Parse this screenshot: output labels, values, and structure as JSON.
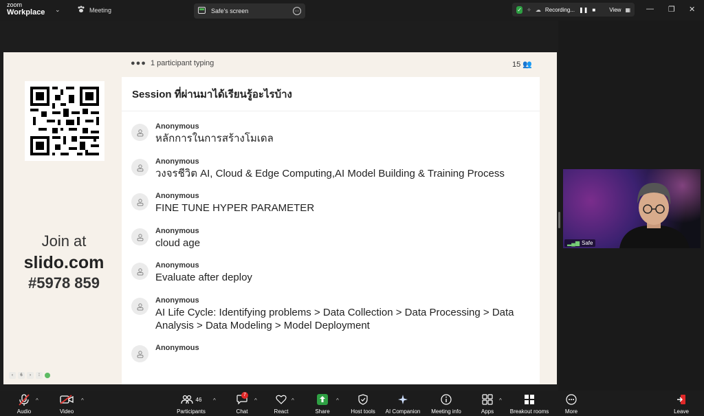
{
  "window": {
    "app_small": "zoom",
    "app_big": "Workplace",
    "meeting_tab": "Meeting",
    "screen_tab": "Safe's screen",
    "recording_label": "Recording...",
    "view_label": "View"
  },
  "slide": {
    "typing_text": "1 participant typing",
    "typing_dots": "●●●",
    "participant_count": "15",
    "join_line1": "Join at",
    "join_line2": "slido.com",
    "join_line3": "#5978 859",
    "question_title": "Session ที่ผ่านมาได้เรียนรู้อะไรบ้าง",
    "responses": [
      {
        "name": "Anonymous",
        "text": "หลักการในการสร้างโมเดล"
      },
      {
        "name": "Anonymous",
        "text": "วงจรชีวิต AI, Cloud & Edge Computing,AI Model Building & Training Process"
      },
      {
        "name": "Anonymous",
        "text": "FINE TUNE HYPER PARAMETER"
      },
      {
        "name": "Anonymous",
        "text": "cloud age"
      },
      {
        "name": "Anonymous",
        "text": "Evaluate after deploy"
      },
      {
        "name": "Anonymous",
        "text": "AI Life Cycle: Identifying problems > Data Collection > Data Processing > Data Analysis > Data Modeling > Model Deployment"
      },
      {
        "name": "Anonymous",
        "text": ""
      }
    ],
    "pager": {
      "prev": "‹",
      "page": "6",
      "next": "›",
      "sep": "⁞"
    }
  },
  "video": {
    "name": "Safe"
  },
  "toolbar": {
    "audio": "Audio",
    "video": "Video",
    "participants": "Participants",
    "participants_count": "46",
    "chat": "Chat",
    "chat_badge": "7",
    "react": "React",
    "share": "Share",
    "host_tools": "Host tools",
    "ai_companion": "AI Companion",
    "meeting_info": "Meeting info",
    "apps": "Apps",
    "breakout_rooms": "Breakout rooms",
    "more": "More",
    "leave": "Leave"
  }
}
